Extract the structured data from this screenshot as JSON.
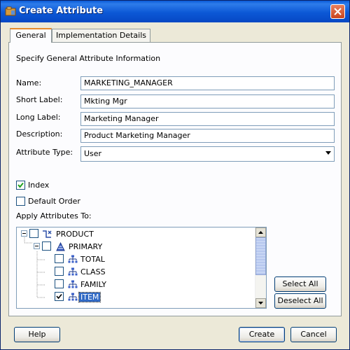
{
  "window": {
    "title": "Create Attribute"
  },
  "tabs": [
    {
      "label": "General",
      "active": true
    },
    {
      "label": "Implementation Details",
      "active": false
    }
  ],
  "section_heading": "Specify General Attribute Information",
  "fields": {
    "name": {
      "label": "Name:",
      "value": "MARKETING_MANAGER"
    },
    "short_label": {
      "label": "Short Label:",
      "value": "Mkting Mgr"
    },
    "long_label": {
      "label": "Long Label:",
      "value": "Marketing Manager"
    },
    "description": {
      "label": "Description:",
      "value": "Product Marketing Manager"
    },
    "attribute_type": {
      "label": "Attribute Type:",
      "value": "User"
    }
  },
  "checkboxes": {
    "index": {
      "label": "Index",
      "checked": true
    },
    "default_order": {
      "label": "Default Order",
      "checked": false
    }
  },
  "apply_label": "Apply Attributes To:",
  "tree": {
    "product": {
      "label": "PRODUCT",
      "checked": false,
      "expanded": true
    },
    "primary": {
      "label": "PRIMARY",
      "checked": false,
      "expanded": true
    },
    "total": {
      "label": "TOTAL",
      "checked": false
    },
    "class": {
      "label": "CLASS",
      "checked": false
    },
    "family": {
      "label": "FAMILY",
      "checked": false
    },
    "item": {
      "label": "ITEM",
      "checked": true,
      "selected": true
    }
  },
  "buttons": {
    "select_all": "Select All",
    "deselect_all": "Deselect All",
    "help": "Help",
    "create": "Create",
    "cancel": "Cancel"
  },
  "colors": {
    "title_bar": "#0A5BD8",
    "selection": "#316AC5",
    "tab_accent": "#E68B2C"
  }
}
